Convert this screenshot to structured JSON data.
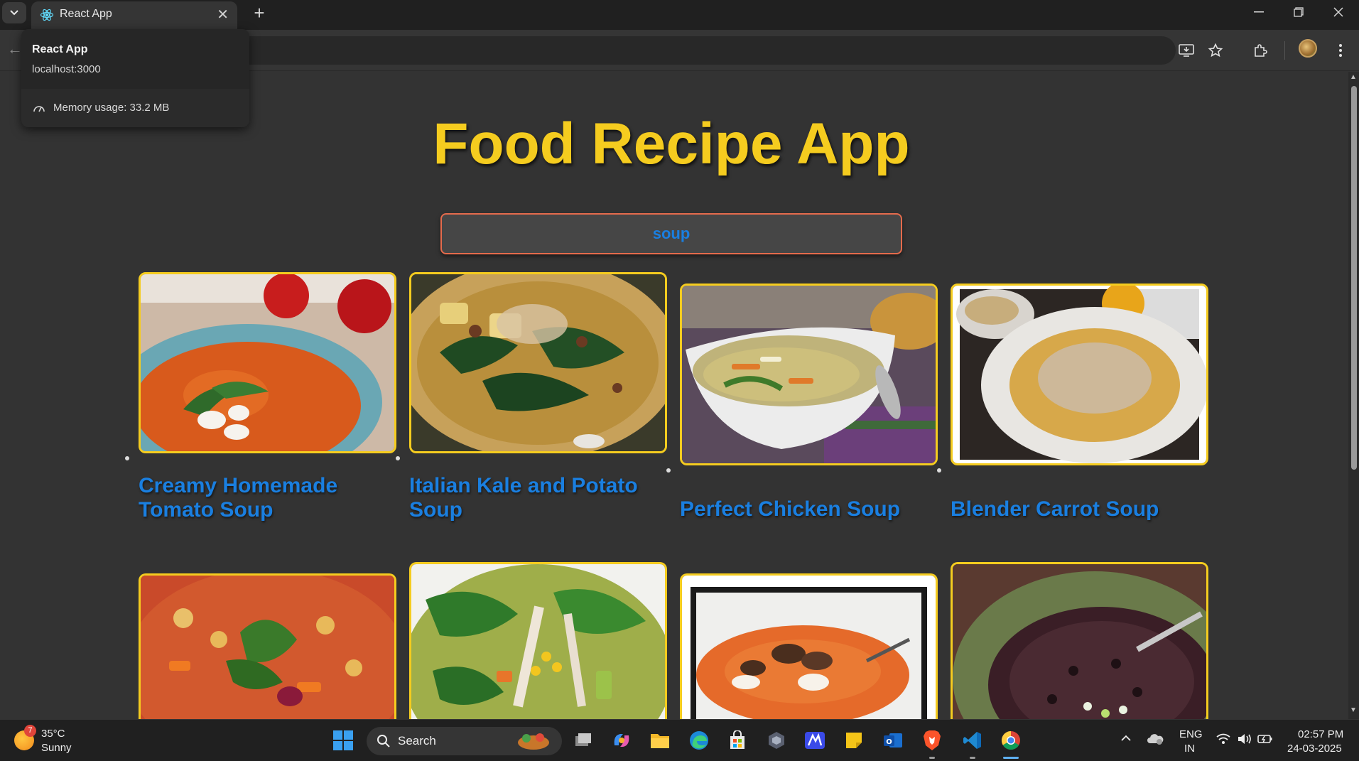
{
  "browser": {
    "tab_title": "React App",
    "hovercard": {
      "title": "React App",
      "url": "localhost:3000",
      "memory": "Memory usage: 33.2 MB"
    }
  },
  "app": {
    "title": "Food Recipe App",
    "search_value": "soup",
    "accent_title": "#f5cc1f",
    "accent_link": "#1a7fe0",
    "search_border": "#e56b4c"
  },
  "recipes": [
    {
      "title": "Creamy Homemade Tomato Soup",
      "image": "tomato-soup-photo"
    },
    {
      "title": "Italian Kale and Potato Soup",
      "image": "kale-potato-soup-photo"
    },
    {
      "title": "Perfect Chicken Soup",
      "image": "chicken-noodle-soup-photo"
    },
    {
      "title": "Blender Carrot Soup",
      "image": "carrot-soup-photo"
    },
    {
      "title": "",
      "image": "minestrone-soup-photo"
    },
    {
      "title": "",
      "image": "chicken-vegetable-soup-photo"
    },
    {
      "title": "",
      "image": "mushroom-soup-photo"
    },
    {
      "title": "",
      "image": "black-bean-soup-photo"
    }
  ],
  "taskbar": {
    "weather_badge": "7",
    "temperature": "35°C",
    "condition": "Sunny",
    "search_label": "Search",
    "lang_line1": "ENG",
    "lang_line2": "IN",
    "time": "02:57 PM",
    "date": "24-03-2025"
  }
}
